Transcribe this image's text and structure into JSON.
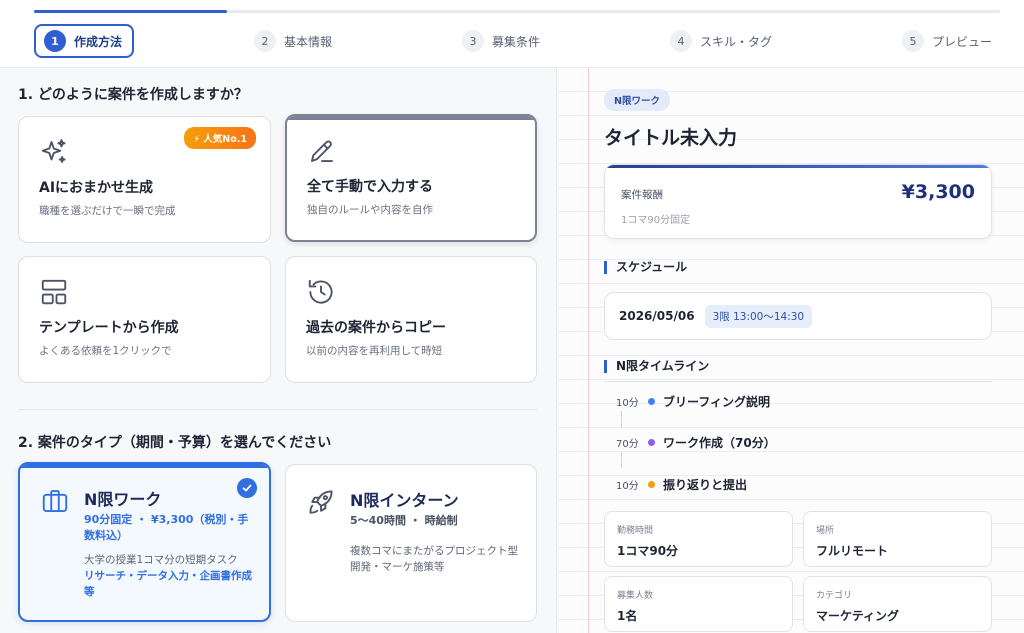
{
  "stepper": {
    "progress": 0.2,
    "steps": [
      {
        "num": "1",
        "label": "作成方法"
      },
      {
        "num": "2",
        "label": "基本情報"
      },
      {
        "num": "3",
        "label": "募集条件"
      },
      {
        "num": "4",
        "label": "スキル・タグ"
      },
      {
        "num": "5",
        "label": "プレビュー"
      }
    ]
  },
  "creation": {
    "heading": "1. どのように案件を作成しますか？",
    "options": [
      {
        "title": "AIにおまかせ生成",
        "desc": "職種を選ぶだけで一瞬で完成",
        "badge": "人気No.1",
        "icon": "sparkles-icon"
      },
      {
        "title": "全て手動で入力する",
        "desc": "独自のルールや内容を自作",
        "icon": "pencil-icon"
      },
      {
        "title": "テンプレートから作成",
        "desc": "よくある依頼を1クリックで",
        "icon": "layout-template-icon"
      },
      {
        "title": "過去の案件からコピー",
        "desc": "以前の内容を再利用して時短",
        "icon": "history-icon"
      }
    ]
  },
  "job_type": {
    "heading": "2. 案件のタイプ（期間・予算）を選んでください",
    "options": [
      {
        "title": "N限ワーク",
        "sub": "90分固定 ・ ¥3,300（税別・手数料込）",
        "desc_plain": "大学の授業1コマ分の短期タスク",
        "desc_accent": "リサーチ・データ入力・企画書作成等",
        "icon": "briefcase-icon",
        "accent": "#2f6fe0"
      },
      {
        "title": "N限インターン",
        "sub": "5〜40時間 ・ 時給制",
        "desc_plain": "複数コマにまたがるプロジェクト型",
        "desc_accent": "開発・マーケ施策等",
        "icon": "rocket-icon",
        "accent": "#1f2433"
      }
    ]
  },
  "preview": {
    "tag": "N限ワーク",
    "title": "タイトル未入力",
    "fee": {
      "label": "案件報酬",
      "value": "¥3,300",
      "note": "1コマ90分固定"
    },
    "schedule": {
      "heading": "スケジュール",
      "date": "2026/05/06",
      "slot": "3限 13:00〜14:30"
    },
    "timeline": {
      "heading": "N限タイムライン",
      "items": [
        {
          "duration": "10分",
          "label": "ブリーフィング説明",
          "color": "#3b82f6"
        },
        {
          "duration": "70分",
          "label": "ワーク作成（70分）",
          "color": "#8b5cf6"
        },
        {
          "duration": "10分",
          "label": "振り返りと提出",
          "color": "#f59e0b"
        }
      ]
    },
    "info": [
      {
        "label": "勤務時間",
        "value": "1コマ90分"
      },
      {
        "label": "場所",
        "value": "フルリモート"
      },
      {
        "label": "募集人数",
        "value": "1名"
      },
      {
        "label": "カテゴリ",
        "value": "マーケティング"
      }
    ]
  }
}
